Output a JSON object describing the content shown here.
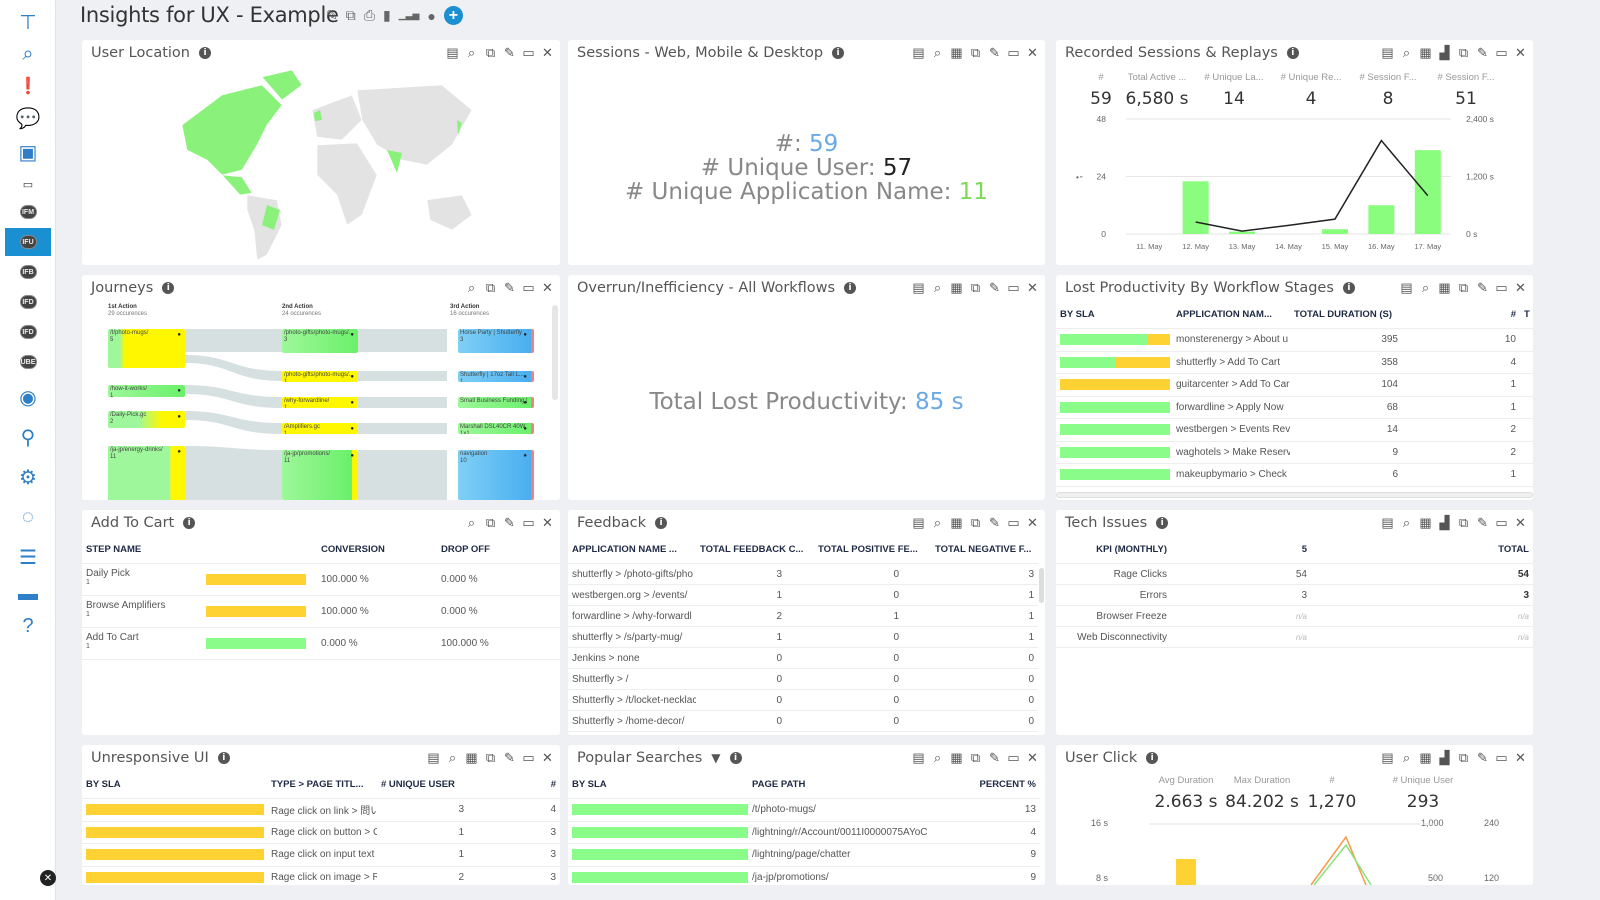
{
  "header": {
    "title": "Insights for UX - Example",
    "icons": [
      "edit-icon",
      "copy-icon",
      "print-icon",
      "bookmark-icon",
      "bar-chart-icon",
      "comment-icon",
      "add-icon"
    ]
  },
  "sidebar": {
    "items": [
      {
        "icon": "sitemap-icon"
      },
      {
        "icon": "search-icon"
      },
      {
        "icon": "alert-icon"
      },
      {
        "icon": "chat-icon"
      },
      {
        "icon": "monitor-chart-icon"
      },
      {
        "icon": "grid-icon"
      },
      {
        "icon": "pill",
        "label": "IFM"
      },
      {
        "icon": "pill",
        "label": "IFU",
        "selected": true
      },
      {
        "icon": "pill",
        "label": "IFB"
      },
      {
        "icon": "pill",
        "label": "IFD"
      },
      {
        "icon": "pill",
        "label": "IFD"
      },
      {
        "icon": "pill",
        "label": "UBE"
      },
      {
        "icon": "database-icon"
      },
      {
        "icon": "network-icon"
      },
      {
        "icon": "gear-icon"
      },
      {
        "icon": "loading-circle-icon"
      },
      {
        "icon": "sliders-icon"
      },
      {
        "icon": "save-icon"
      },
      {
        "icon": "help-icon"
      }
    ]
  },
  "panels": {
    "user_location": {
      "title": "User Location",
      "tools": [
        "csv",
        "zoom",
        "copy",
        "edit",
        "maximize",
        "close"
      ],
      "colors": {
        "active": "#8af27a",
        "inactive": "#e3e3e3"
      }
    },
    "sessions": {
      "title": "Sessions - Web, Mobile & Desktop",
      "tools": [
        "csv",
        "zoom",
        "calendar",
        "copy",
        "edit",
        "maximize",
        "close"
      ],
      "count_label": "#: ",
      "count": "59",
      "unique_user_label": "# Unique User: ",
      "unique_user": "57",
      "unique_app_label": "# Unique Application Name: ",
      "unique_app": "11"
    },
    "recorded": {
      "title": "Recorded Sessions & Replays",
      "tools": [
        "csv",
        "zoom",
        "calendar",
        "bars",
        "copy",
        "edit",
        "maximize",
        "close"
      ],
      "kpis": [
        {
          "label": "#",
          "value": "59"
        },
        {
          "label": "Total Active ...",
          "value": "6,580 s"
        },
        {
          "label": "# Unique La...",
          "value": "14"
        },
        {
          "label": "# Unique Re...",
          "value": "4"
        },
        {
          "label": "# Session F...",
          "value": "8"
        },
        {
          "label": "# Session F...",
          "value": "51"
        }
      ]
    },
    "journeys": {
      "title": "Journeys",
      "tools": [
        "zoom",
        "copy",
        "edit",
        "maximize",
        "close"
      ],
      "columns": [
        {
          "title": "1st Action",
          "sub": "29 occurences"
        },
        {
          "title": "2nd Action",
          "sub": "24 occurences"
        },
        {
          "title": "3rd Action",
          "sub": "16 occurences"
        }
      ],
      "nodes": [
        {
          "label": "/t/photo-mugs/",
          "count": "5"
        },
        {
          "label": "/how-it-works/",
          "count": "1"
        },
        {
          "label": "/Daily-Pick.gc",
          "count": "2"
        },
        {
          "label": "/ja-jp/energy-drinks/",
          "count": "11"
        },
        {
          "label": "/photo-gifts/photo-mugs/...",
          "count": "3"
        },
        {
          "label": "/photo-gifts/photo-mugs/...",
          "count": "1"
        },
        {
          "label": "/why-forwardline/",
          "count": "1"
        },
        {
          "label": "/Amplifiers.gc",
          "count": "1"
        },
        {
          "label": "/ja-jp/promotions/",
          "count": "11"
        },
        {
          "label": "Horse Party | Shutterfly",
          "count": "3"
        },
        {
          "label": "Shutterfly | 17oz Tall L...",
          "count": "1"
        },
        {
          "label": "Small Business Funding | ...",
          "count": "1"
        },
        {
          "label": "Marshall DSL40CR 40W 1x1...",
          "count": "1"
        },
        {
          "label": "navigation",
          "count": "10"
        }
      ]
    },
    "overrun": {
      "title": "Overrun/Inefficiency - All Workflows",
      "tools": [
        "csv",
        "zoom",
        "calendar",
        "copy",
        "edit",
        "maximize",
        "close"
      ],
      "label": "Total Lost Productivity: ",
      "value": "85 s"
    },
    "lost": {
      "title": "Lost Productivity By Workflow Stages",
      "tools": [
        "csv",
        "zoom",
        "calendar",
        "copy",
        "edit",
        "maximize",
        "close"
      ],
      "columns": [
        "BY SLA",
        "APPLICATION NAM...",
        "TOTAL DURATION (S)",
        "#",
        "T"
      ],
      "rows": [
        {
          "sla_ok": 0.8,
          "app": "monsterenergy > About u",
          "duration": "395",
          "count": "10"
        },
        {
          "sla_ok": 0.5,
          "app": "shutterfly > Add To Cart",
          "duration": "358",
          "count": "4"
        },
        {
          "sla_ok": 0,
          "app": "guitarcenter > Add To Car",
          "duration": "104",
          "count": "1"
        },
        {
          "sla_ok": 1,
          "app": "forwardline > Apply Now",
          "duration": "68",
          "count": "1"
        },
        {
          "sla_ok": 1,
          "app": "westbergen > Events Revi",
          "duration": "14",
          "count": "2"
        },
        {
          "sla_ok": 1,
          "app": "waghotels > Make Reserv.",
          "duration": "9",
          "count": "2"
        },
        {
          "sla_ok": 1,
          "app": "makeupbymario > Check",
          "duration": "6",
          "count": "1"
        }
      ]
    },
    "cart": {
      "title": "Add To Cart",
      "tools": [
        "zoom",
        "copy",
        "edit",
        "maximize",
        "close"
      ],
      "columns": [
        "STEP NAME",
        "",
        "CONVERSION",
        "DROP OFF"
      ],
      "rows": [
        {
          "step": "Daily Pick",
          "n": "1",
          "status": "warn",
          "conversion": "100.000 %",
          "dropoff": "0.000 %"
        },
        {
          "step": "Browse Amplifiers",
          "n": "1",
          "status": "warn",
          "conversion": "100.000 %",
          "dropoff": "0.000 %"
        },
        {
          "step": "Add To Cart",
          "n": "1",
          "status": "ok",
          "conversion": "0.000 %",
          "dropoff": "100.000 %"
        }
      ]
    },
    "feedback": {
      "title": "Feedback",
      "tools": [
        "csv",
        "zoom",
        "calendar",
        "copy",
        "edit",
        "maximize",
        "close"
      ],
      "columns": [
        "APPLICATION NAME ...",
        "TOTAL FEEDBACK C...",
        "TOTAL POSITIVE FE...",
        "TOTAL NEGATIVE F..."
      ],
      "rows": [
        [
          "shutterfly > /photo-gifts/pho",
          "3",
          "0",
          "3"
        ],
        [
          "westbergen.org > /events/",
          "1",
          "0",
          "1"
        ],
        [
          "forwardline > /why-forwardl",
          "2",
          "1",
          "1"
        ],
        [
          "shutterfly > /s/party-mug/",
          "1",
          "0",
          "1"
        ],
        [
          "Jenkins > none",
          "0",
          "0",
          "0"
        ],
        [
          "Shutterfly > /",
          "0",
          "0",
          "0"
        ],
        [
          "Shutterfly > /t/locket-necklac",
          "0",
          "0",
          "0"
        ],
        [
          "Shutterfly > /home-decor/",
          "0",
          "0",
          "0"
        ]
      ]
    },
    "tech": {
      "title": "Tech Issues",
      "tools": [
        "csv",
        "zoom",
        "calendar",
        "bars",
        "copy",
        "edit",
        "maximize",
        "close"
      ],
      "columns": [
        "KPI (MONTHLY)",
        "5",
        "TOTAL"
      ],
      "rows": [
        [
          "Rage Clicks",
          "54",
          "54"
        ],
        [
          "Errors",
          "3",
          "3"
        ],
        [
          "Browser Freeze",
          "n/a",
          "n/a"
        ],
        [
          "Web Disconnectivity",
          "n/a",
          "n/a"
        ]
      ]
    },
    "unresponsive": {
      "title": "Unresponsive UI",
      "tools": [
        "csv",
        "zoom",
        "calendar",
        "copy",
        "edit",
        "maximize",
        "close"
      ],
      "columns": [
        "BY SLA",
        "TYPE > PAGE TITL...",
        "# UNIQUE USER",
        "#"
      ],
      "rows": [
        [
          "Rage click on link > 問い",
          "3",
          "4"
        ],
        [
          "Rage click on button > G",
          "1",
          "3"
        ],
        [
          "Rage click on input text :",
          "1",
          "3"
        ],
        [
          "Rage click on image > Re",
          "2",
          "3"
        ]
      ]
    },
    "popular": {
      "title": "Popular Searches",
      "tools": [
        "csv",
        "zoom",
        "calendar",
        "copy",
        "edit",
        "maximize",
        "close"
      ],
      "columns": [
        "BY SLA",
        "PAGE PATH",
        "PERCENT %"
      ],
      "rows": [
        [
          "/t/photo-mugs/",
          "13"
        ],
        [
          "/lightning/r/Account/0011I0000075AYoC",
          "4"
        ],
        [
          "/lightning/page/chatter",
          "9"
        ],
        [
          "/ja-jp/promotions/",
          "9"
        ]
      ]
    },
    "user_click": {
      "title": "User Click",
      "tools": [
        "csv",
        "zoom",
        "calendar",
        "bars",
        "copy",
        "edit",
        "maximize",
        "close"
      ],
      "kpis": [
        {
          "label": "Avg Duration",
          "value": "2.663 s"
        },
        {
          "label": "Max Duration",
          "value": "84.202 s"
        },
        {
          "label": "#",
          "value": "1,270"
        },
        {
          "label": "# Unique User",
          "value": "293"
        }
      ],
      "axes": {
        "left": [
          "16 s",
          "8 s"
        ],
        "right1": [
          "1,000",
          "500"
        ],
        "right2": [
          "240",
          "120"
        ]
      }
    }
  },
  "chart_data": {
    "type": "bar+line",
    "categories": [
      "11. May",
      "12. May",
      "13. May",
      "14. May",
      "15. May",
      "16. May",
      "17. May"
    ],
    "series": [
      {
        "type": "bar",
        "axis": "left",
        "color": "#8afc7e",
        "values": [
          0,
          22,
          1,
          0,
          2,
          12,
          35
        ]
      },
      {
        "type": "line",
        "axis": "right",
        "color": "#222222",
        "values": [
          null,
          250,
          60,
          180,
          310,
          1950,
          800
        ]
      }
    ],
    "ylim_left": [
      0,
      48
    ],
    "yticks_left": [
      "0",
      "24",
      "48"
    ],
    "ylim_right": [
      0,
      2400
    ],
    "yticks_right": [
      "0 s",
      "1,200 s",
      "2,400 s"
    ],
    "grid": true
  }
}
